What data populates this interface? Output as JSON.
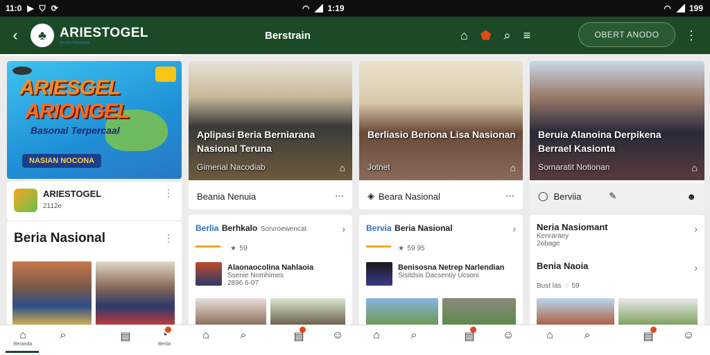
{
  "status": {
    "time_left": "11:0",
    "time_center": "1:19",
    "battery": "199"
  },
  "appbar": {
    "brand": "ARIESTOGEL",
    "brand_tag": "Berita Nasional",
    "title": "Berstrain",
    "cta": "OBERT ANODO"
  },
  "hero": {
    "line1": "ARIESGEL",
    "line2": "ARIONGEL",
    "line3": "Basonal Terpercaal",
    "pill": "NASIAN NOCONA"
  },
  "profile": {
    "name": "ARIESTOGEL",
    "sub": "2112e"
  },
  "section": {
    "title": "Beria Nasional"
  },
  "cards": [
    {
      "overlay1": "Aplipasi Beria Berniarana Nasional Teruna",
      "overlay2": "Gimerial Nacodiab",
      "footer": "Beania Nenuia"
    },
    {
      "overlay1": "Berliasio Beriona Lisa Nasionan",
      "overlay2": "Jotnet",
      "footer": "Beara Nasional"
    },
    {
      "overlay1": "Beruia Alanoina Derpikena Berrael Kasionta",
      "overlay2": "Sornaratit Notionan",
      "footer": "Berviia"
    }
  ],
  "lists": [
    {
      "tag": "Berlia",
      "title": "Berhkalo",
      "meta": "Sorvroewencat",
      "meta2": "59",
      "title2": "Alaonaocolina Nahlaoia",
      "meta3": "Ssenie Nomhimes",
      "meta4": "2896 6-07"
    },
    {
      "tag": "Bervia",
      "title": "Beria Nasional",
      "meta": "59 95",
      "meta2": "",
      "title2": "Benisosna Netrep Narlendian",
      "meta3": "Sisitdsis Dacsentiy Ucsoni",
      "meta4": ""
    },
    {
      "tag": "",
      "title": "Neria Nasiomant",
      "meta": "Kenraraey",
      "meta2": "2obage",
      "title2": "Benia Naoia",
      "meta3": "Bust  las",
      "meta4": "59"
    }
  ],
  "nav": {
    "home_label": "Beranda",
    "news_label": "Berita"
  },
  "colors": {
    "primary": "#1c4a27",
    "accent": "#e04a1a"
  }
}
